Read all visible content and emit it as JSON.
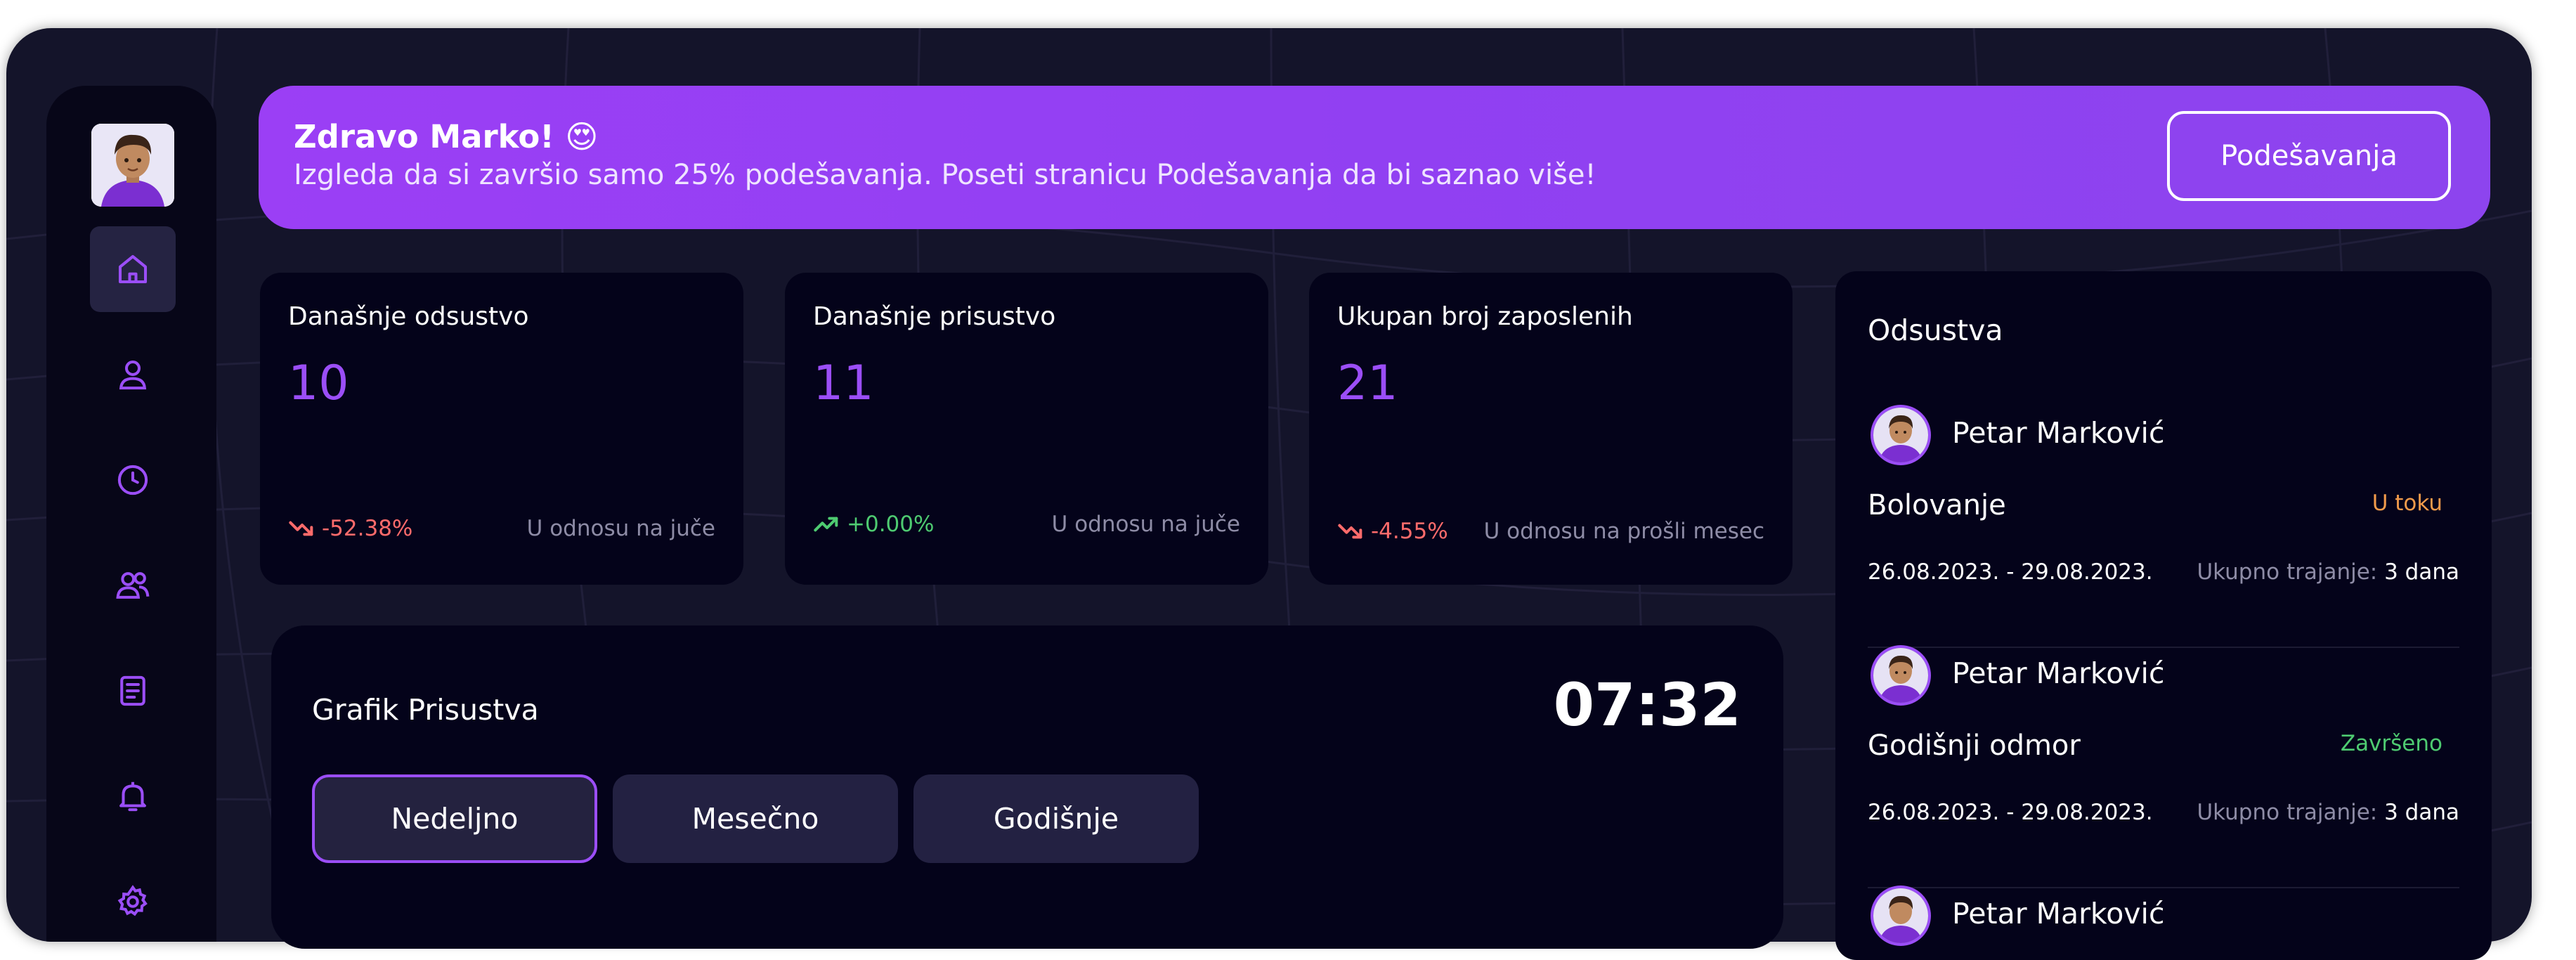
{
  "banner": {
    "title": "Zdravo Marko! 😍",
    "subtitle": "Izgleda da si završio samo 25% podešavanja. Poseti stranicu Podešavanja da bi saznao više!",
    "button_label": "Podešavanja"
  },
  "sidebar": {
    "items": [
      {
        "icon": "home-icon",
        "active": true
      },
      {
        "icon": "user-icon"
      },
      {
        "icon": "clock-icon"
      },
      {
        "icon": "users-icon"
      },
      {
        "icon": "document-icon"
      },
      {
        "icon": "bell-icon"
      },
      {
        "icon": "gear-icon"
      }
    ]
  },
  "stats": [
    {
      "title": "Današnje odsustvo",
      "value": "10",
      "trend": "-52.38%",
      "direction": "down",
      "note": "U odnosu na juče"
    },
    {
      "title": "Današnje prisustvo",
      "value": "11",
      "trend": "+0.00%",
      "direction": "up",
      "note": "U odnosu na juče"
    },
    {
      "title": "Ukupan broj zaposlenih",
      "value": "21",
      "trend": "-4.55%",
      "direction": "down",
      "note": "U odnosu na prošli mesec"
    }
  ],
  "attendance_chart": {
    "title": "Grafik Prisustva",
    "clock": "07:32",
    "periods": [
      "Nedeljno",
      "Mesečno",
      "Godišnje"
    ],
    "active_period": "Nedeljno"
  },
  "absences": {
    "title": "Odsustva",
    "duration_label": "Ukupno trajanje:",
    "items": [
      {
        "name": "Petar Marković",
        "type": "Bolovanje",
        "status": "U toku",
        "status_color": "#f29b4b",
        "dates": "26.08.2023. - 29.08.2023.",
        "duration": "3 dana"
      },
      {
        "name": "Petar Marković",
        "type": "Godišnji odmor",
        "status": "Završeno",
        "status_color": "#4ecb71",
        "dates": "26.08.2023. - 29.08.2023.",
        "duration": "3 dana"
      },
      {
        "name": "Petar Marković"
      }
    ]
  },
  "colors": {
    "accent": "#9b4ef7",
    "banner": "#9140f2",
    "card": "#04031a",
    "background": "#14142a",
    "trend_down": "#ff6b6b",
    "trend_up": "#4ecb71"
  }
}
